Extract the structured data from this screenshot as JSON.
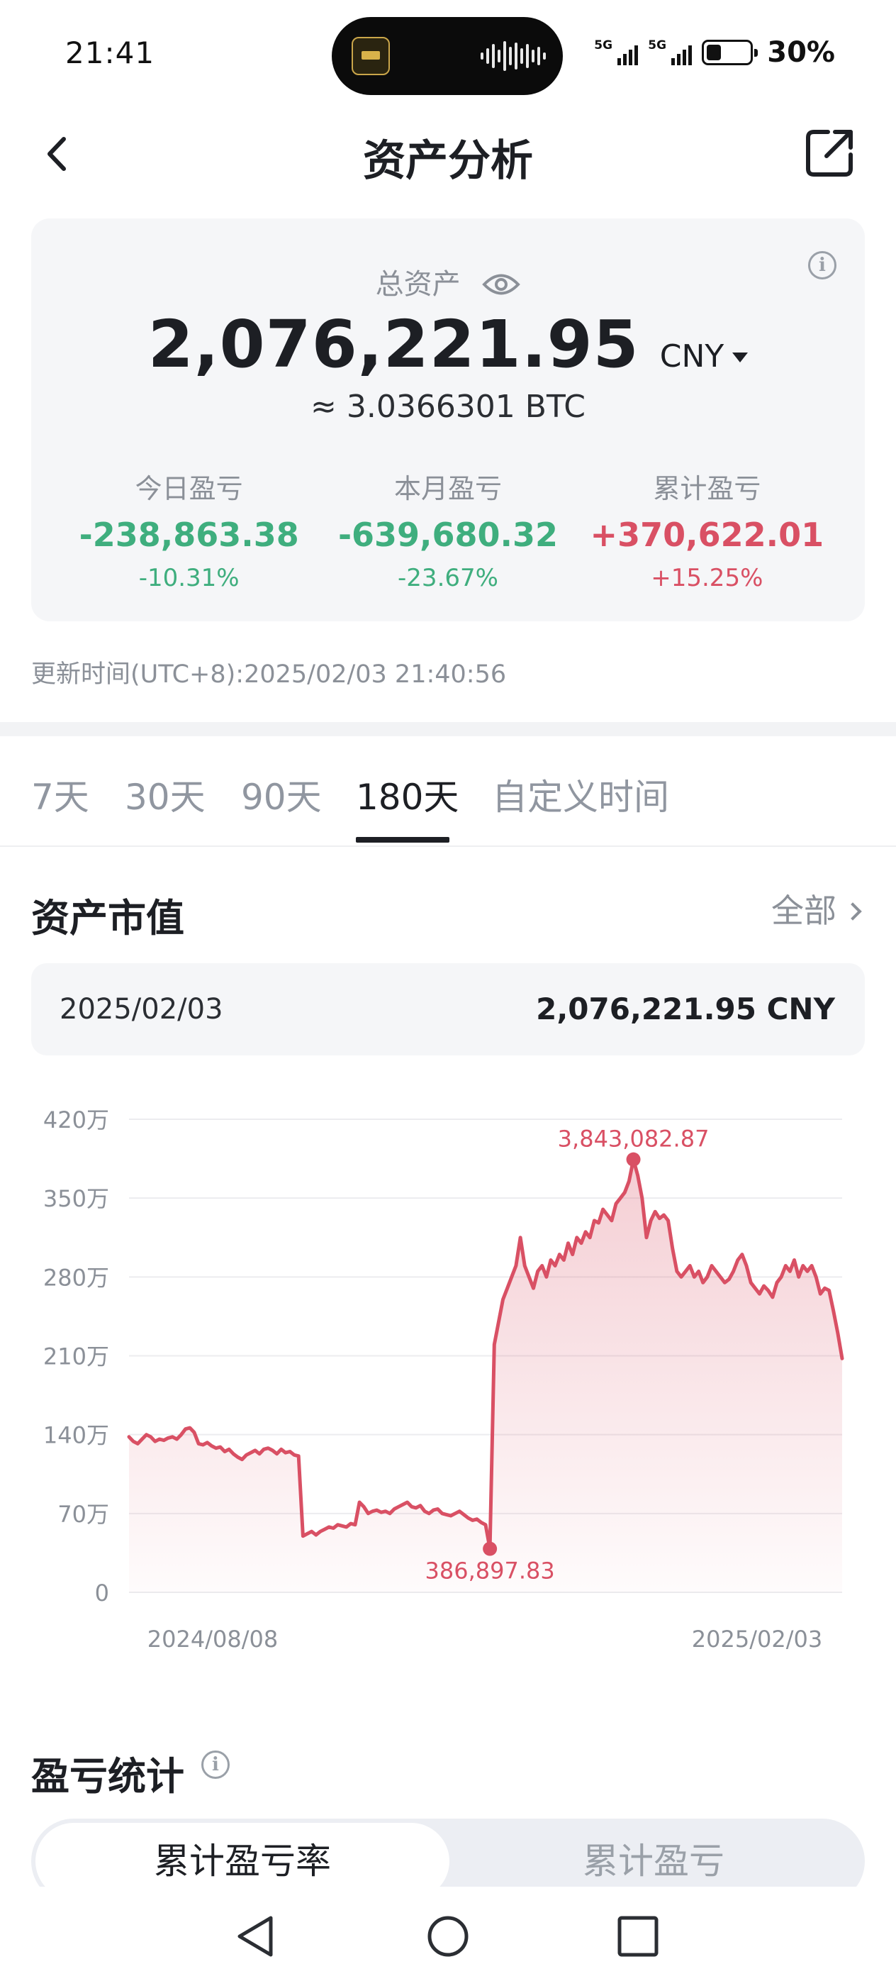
{
  "status_bar": {
    "time": "21:41",
    "signal1": "5G",
    "signal2": "5G",
    "battery": "30%"
  },
  "nav": {
    "title": "资产分析"
  },
  "assets": {
    "total_label": "总资产",
    "total_value": "2,076,221.95",
    "currency": "CNY",
    "btc_equiv": "≈ 3.0366301 BTC",
    "pnl": [
      {
        "label": "今日盈亏",
        "value": "-238,863.38",
        "pct": "-10.31%",
        "tone": "green"
      },
      {
        "label": "本月盈亏",
        "value": "-639,680.32",
        "pct": "-23.67%",
        "tone": "green"
      },
      {
        "label": "累计盈亏",
        "value": "+370,622.01",
        "pct": "+15.25%",
        "tone": "red"
      }
    ]
  },
  "update_time": "更新时间(UTC+8):2025/02/03 21:40:56",
  "tabs": [
    "7天",
    "30天",
    "90天",
    "180天",
    "自定义时间"
  ],
  "active_tab": "180天",
  "market_value": {
    "title": "资产市值",
    "all_label": "全部",
    "selected_date": "2025/02/03",
    "selected_value": "2,076,221.95 CNY"
  },
  "chart_data": {
    "type": "area",
    "y_tick_labels": [
      "420万",
      "350万",
      "280万",
      "210万",
      "140万",
      "70万",
      "0"
    ],
    "ylim": [
      0,
      4200000
    ],
    "x_tick_labels": [
      "2024/08/08",
      "2025/02/03"
    ],
    "annotations": [
      {
        "label": "3,843,082.87",
        "value": 3843082.87,
        "kind": "max"
      },
      {
        "label": "386,897.83",
        "value": 386897.83,
        "kind": "min"
      }
    ],
    "color": "#d95064",
    "grid": true,
    "series": [
      {
        "values": [
          1380000,
          1340000,
          1320000,
          1360000,
          1400000,
          1380000,
          1340000,
          1360000,
          1350000,
          1370000,
          1380000,
          1360000,
          1400000,
          1450000,
          1460000,
          1420000,
          1320000,
          1310000,
          1330000,
          1300000,
          1280000,
          1290000,
          1250000,
          1270000,
          1230000,
          1200000,
          1180000,
          1220000,
          1240000,
          1260000,
          1230000,
          1270000,
          1280000,
          1260000,
          1230000,
          1270000,
          1240000,
          1250000,
          1220000,
          1210000,
          500000,
          520000,
          540000,
          510000,
          540000,
          560000,
          580000,
          570000,
          600000,
          590000,
          580000,
          610000,
          600000,
          800000,
          760000,
          700000,
          720000,
          730000,
          710000,
          720000,
          700000,
          740000,
          760000,
          780000,
          800000,
          760000,
          750000,
          770000,
          720000,
          700000,
          730000,
          740000,
          700000,
          690000,
          680000,
          700000,
          720000,
          690000,
          660000,
          640000,
          650000,
          620000,
          600000,
          386897.83,
          2200000,
          2400000,
          2600000,
          2700000,
          2800000,
          2900000,
          3150000,
          2900000,
          2800000,
          2700000,
          2850000,
          2900000,
          2800000,
          2950000,
          2900000,
          3000000,
          2950000,
          3100000,
          3000000,
          3150000,
          3100000,
          3200000,
          3150000,
          3300000,
          3280000,
          3400000,
          3350000,
          3300000,
          3450000,
          3500000,
          3550000,
          3650000,
          3843082.87,
          3700000,
          3500000,
          3150000,
          3300000,
          3380000,
          3320000,
          3350000,
          3300000,
          3050000,
          2850000,
          2800000,
          2850000,
          2900000,
          2800000,
          2850000,
          2750000,
          2800000,
          2900000,
          2850000,
          2800000,
          2750000,
          2780000,
          2850000,
          2950000,
          3000000,
          2900000,
          2750000,
          2700000,
          2650000,
          2720000,
          2680000,
          2620000,
          2750000,
          2800000,
          2900000,
          2850000,
          2950000,
          2800000,
          2900000,
          2850000,
          2900000,
          2800000,
          2650000,
          2700000,
          2680000,
          2500000,
          2300000,
          2076221.95
        ]
      }
    ]
  },
  "pnl_stats": {
    "title": "盈亏统计",
    "segments": [
      "累计盈亏率",
      "累计盈亏"
    ]
  },
  "icons": {
    "back": "chevron-left-icon",
    "share": "share-icon",
    "eye": "eye-icon",
    "info": "info-icon"
  }
}
